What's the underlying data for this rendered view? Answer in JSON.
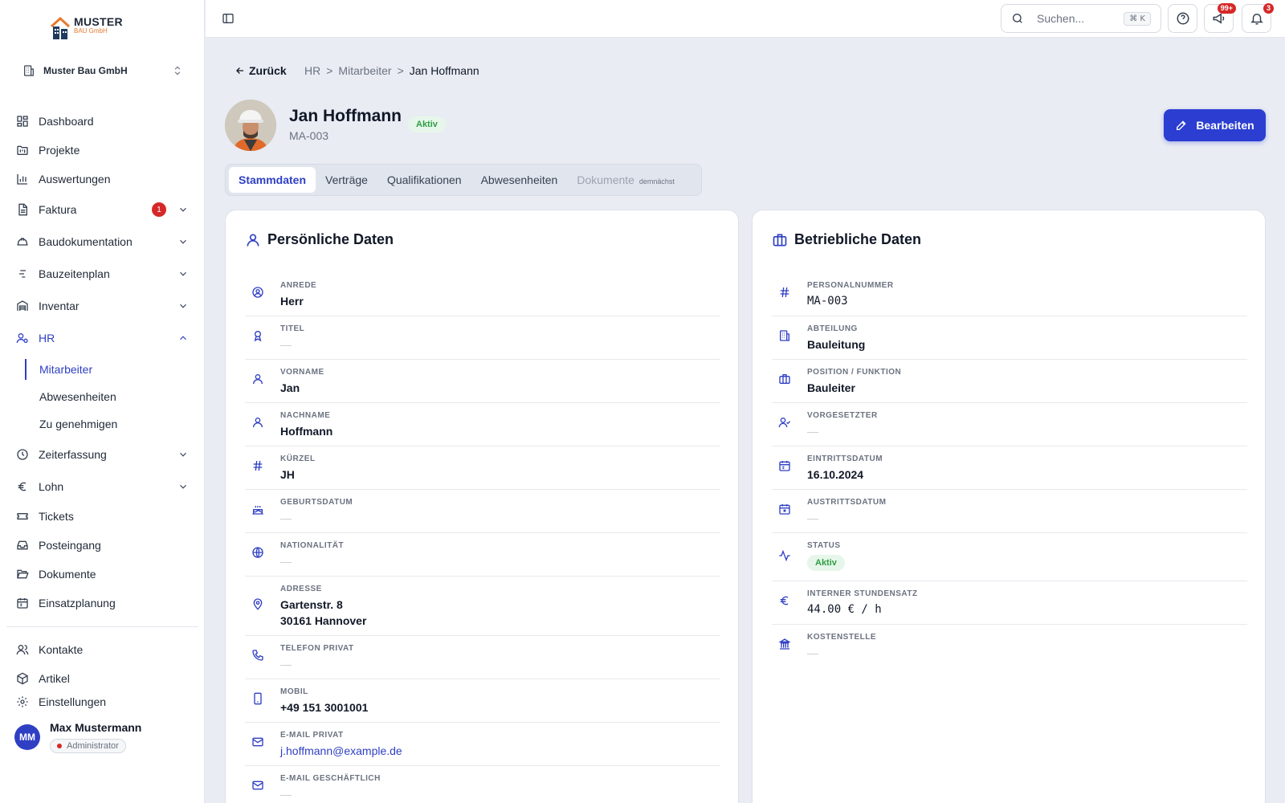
{
  "brand": {
    "name": "MUSTER",
    "sub": "BAU GmbH"
  },
  "company": "Muster Bau GmbH",
  "nav": {
    "dashboard": "Dashboard",
    "projekte": "Projekte",
    "auswertungen": "Auswertungen",
    "faktura": "Faktura",
    "faktura_badge": "1",
    "baudokumentation": "Baudokumentation",
    "bauzeitenplan": "Bauzeitenplan",
    "inventar": "Inventar",
    "hr": "HR",
    "hr_sub": {
      "mitarbeiter": "Mitarbeiter",
      "abwesenheiten": "Abwesenheiten",
      "zu_genehmigen": "Zu genehmigen"
    },
    "zeiterfassung": "Zeiterfassung",
    "lohn": "Lohn",
    "tickets": "Tickets",
    "posteingang": "Posteingang",
    "dokumente": "Dokumente",
    "einsatzplanung": "Einsatzplanung",
    "kontakte": "Kontakte",
    "artikel": "Artikel",
    "einstellungen": "Einstellungen"
  },
  "user": {
    "initials": "MM",
    "name": "Max Mustermann",
    "role": "Administrator"
  },
  "topbar": {
    "search_placeholder": "Suchen...",
    "shortcut": "⌘ K",
    "announce_badge": "99+",
    "notif_badge": "3"
  },
  "breadcrumb": {
    "back": "Zurück",
    "items": [
      "HR",
      ">",
      "Mitarbeiter",
      ">",
      "Jan Hoffmann"
    ]
  },
  "profile": {
    "name": "Jan Hoffmann",
    "id": "MA-003",
    "status": "Aktiv",
    "edit": "Bearbeiten"
  },
  "tabs": {
    "stammdaten": "Stammdaten",
    "vertraege": "Verträge",
    "qualifikationen": "Qualifikationen",
    "abwesenheiten": "Abwesenheiten",
    "dokumente": "Dokumente",
    "soon": "demnächst"
  },
  "personal": {
    "title": "Persönliche Daten",
    "anrede": {
      "label": "ANREDE",
      "value": "Herr"
    },
    "titel": {
      "label": "TITEL",
      "value": "—"
    },
    "vorname": {
      "label": "VORNAME",
      "value": "Jan"
    },
    "nachname": {
      "label": "NACHNAME",
      "value": "Hoffmann"
    },
    "kuerzel": {
      "label": "KÜRZEL",
      "value": "JH"
    },
    "geburtsdatum": {
      "label": "GEBURTSDATUM",
      "value": "—"
    },
    "nationalitaet": {
      "label": "NATIONALITÄT",
      "value": "—"
    },
    "adresse": {
      "label": "ADRESSE",
      "line1": "Gartenstr. 8",
      "line2": "30161 Hannover"
    },
    "telefon": {
      "label": "TELEFON PRIVAT",
      "value": "—"
    },
    "mobil": {
      "label": "MOBIL",
      "value": "+49 151 3001001"
    },
    "email_privat": {
      "label": "E-MAIL PRIVAT",
      "value": "j.hoffmann@example.de"
    },
    "email_geschaeftlich": {
      "label": "E-MAIL GESCHÄFTLICH",
      "value": "—"
    }
  },
  "business": {
    "title": "Betriebliche Daten",
    "personalnummer": {
      "label": "PERSONALNUMMER",
      "value": "MA-003"
    },
    "abteilung": {
      "label": "ABTEILUNG",
      "value": "Bauleitung"
    },
    "position": {
      "label": "POSITION / FUNKTION",
      "value": "Bauleiter"
    },
    "vorgesetzter": {
      "label": "VORGESETZTER",
      "value": "—"
    },
    "eintritt": {
      "label": "EINTRITTSDATUM",
      "value": "16.10.2024"
    },
    "austritt": {
      "label": "AUSTRITTSDATUM",
      "value": "—"
    },
    "status": {
      "label": "STATUS",
      "value": "Aktiv"
    },
    "stundensatz": {
      "label": "INTERNER STUNDENSATZ",
      "value": "44.00 € / h"
    },
    "kostenstelle": {
      "label": "KOSTENSTELLE",
      "value": "—"
    }
  }
}
